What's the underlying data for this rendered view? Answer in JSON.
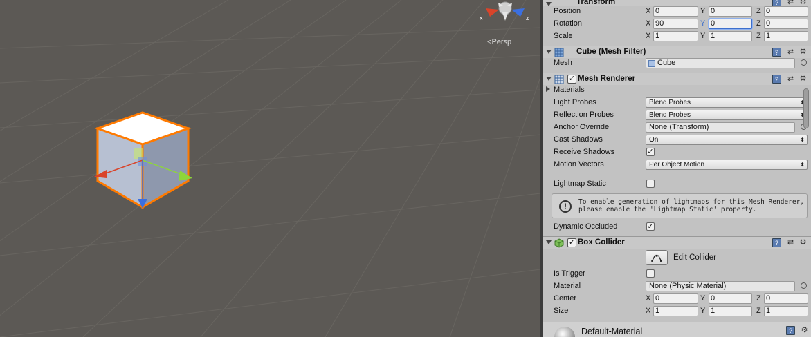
{
  "scene": {
    "projection_label": "Persp",
    "gizmo_axes": {
      "x": "x",
      "z": "z"
    },
    "colors": {
      "background": "#5c5955",
      "selection_outline": "#ff7a00",
      "x_axis": "#d9442a",
      "y_axis": "#8ed63a",
      "z_axis": "#3b6fe0"
    }
  },
  "inspector": {
    "transform": {
      "title": "Transform",
      "position": {
        "label": "Position",
        "x": "0",
        "y": "0",
        "z": "0"
      },
      "rotation": {
        "label": "Rotation",
        "x": "90",
        "y": "0",
        "z": "0"
      },
      "scale": {
        "label": "Scale",
        "x": "1",
        "y": "1",
        "z": "1"
      },
      "axis_labels": {
        "x": "X",
        "y": "Y",
        "z": "Z"
      }
    },
    "mesh_filter": {
      "title": "Cube (Mesh Filter)",
      "mesh_label": "Mesh",
      "mesh_value": "Cube"
    },
    "mesh_renderer": {
      "title": "Mesh Renderer",
      "enabled": true,
      "materials_label": "Materials",
      "light_probes_label": "Light Probes",
      "light_probes_value": "Blend Probes",
      "reflection_probes_label": "Reflection Probes",
      "reflection_probes_value": "Blend Probes",
      "anchor_override_label": "Anchor Override",
      "anchor_override_value": "None (Transform)",
      "cast_shadows_label": "Cast Shadows",
      "cast_shadows_value": "On",
      "receive_shadows_label": "Receive Shadows",
      "receive_shadows_checked": true,
      "motion_vectors_label": "Motion Vectors",
      "motion_vectors_value": "Per Object Motion",
      "lightmap_static_label": "Lightmap Static",
      "lightmap_static_checked": false,
      "help_text": "To enable generation of lightmaps for this Mesh Renderer, please enable the 'Lightmap Static' property.",
      "dynamic_occluded_label": "Dynamic Occluded",
      "dynamic_occluded_checked": true
    },
    "box_collider": {
      "title": "Box Collider",
      "enabled": true,
      "edit_collider_label": "Edit Collider",
      "is_trigger_label": "Is Trigger",
      "is_trigger_checked": false,
      "material_label": "Material",
      "material_value": "None (Physic Material)",
      "center": {
        "label": "Center",
        "x": "0",
        "y": "0",
        "z": "0"
      },
      "size": {
        "label": "Size",
        "x": "1",
        "y": "1",
        "z": "1"
      }
    },
    "material": {
      "name": "Default-Material"
    }
  }
}
